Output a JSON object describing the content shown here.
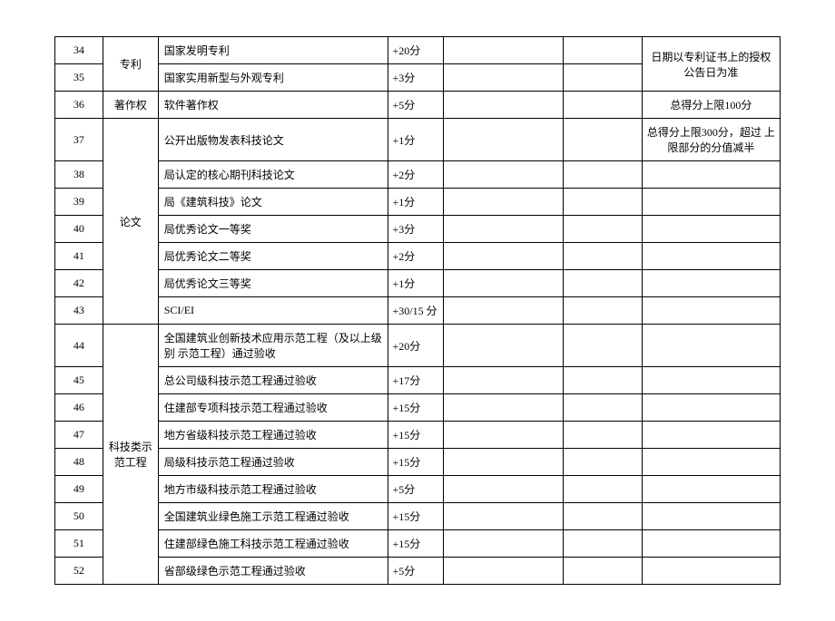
{
  "rows": [
    {
      "num": "34",
      "desc": "国家发明专利",
      "score": "+20分"
    },
    {
      "num": "35",
      "desc": "国家实用新型与外观专利",
      "score": "+3分"
    },
    {
      "num": "36",
      "cat": "著作权",
      "desc": "软件著作权",
      "score": "+5分",
      "note": "总得分上限100分"
    },
    {
      "num": "37",
      "desc": "公开出版物发表科技论文",
      "score": "+1分",
      "note": "总得分上限300分，超过 上限部分的分值减半"
    },
    {
      "num": "38",
      "desc": "局认定的核心期刊科技论文",
      "score": "+2分"
    },
    {
      "num": "39",
      "desc": "局《建筑科技》论文",
      "score": "+1分"
    },
    {
      "num": "40",
      "desc": "局优秀论文一等奖",
      "score": "+3分"
    },
    {
      "num": "41",
      "desc": "局优秀论文二等奖",
      "score": "+2分"
    },
    {
      "num": "42",
      "desc": "局优秀论文三等奖",
      "score": "+1分"
    },
    {
      "num": "43",
      "desc": "SCI/EI",
      "score": "+30/15 分"
    },
    {
      "num": "44",
      "desc": "全国建筑业创新技术应用示范工程（及以上级别 示范工程）通过验收",
      "score": "+20分"
    },
    {
      "num": "45",
      "desc": "总公司级科技示范工程通过验收",
      "score": "+17分"
    },
    {
      "num": "46",
      "desc": "住建部专项科技示范工程通过验收",
      "score": "+15分"
    },
    {
      "num": "47",
      "desc": "地方省级科技示范工程通过验收",
      "score": "+15分"
    },
    {
      "num": "48",
      "desc": "局级科技示范工程通过验收",
      "score": "+15分"
    },
    {
      "num": "49",
      "desc": "地方市级科技示范工程通过验收",
      "score": "+5分"
    },
    {
      "num": "50",
      "desc": "全国建筑业绿色施工示范工程通过验收",
      "score": "+15分"
    },
    {
      "num": "51",
      "desc": "住建部绿色施工科技示范工程通过验收",
      "score": "+15分"
    },
    {
      "num": "52",
      "desc": "省部级绿色示范工程通过验收",
      "score": "+5分"
    }
  ],
  "cats": {
    "patent": "专利",
    "copyright": "著作权",
    "paper": "论文",
    "demo": "科技类示范工程"
  },
  "notes": {
    "patent": "日期以专利证书上的授权公告日为准",
    "copyright": "总得分上限100分",
    "paper": "总得分上限300分，超过 上限部分的分值减半"
  }
}
